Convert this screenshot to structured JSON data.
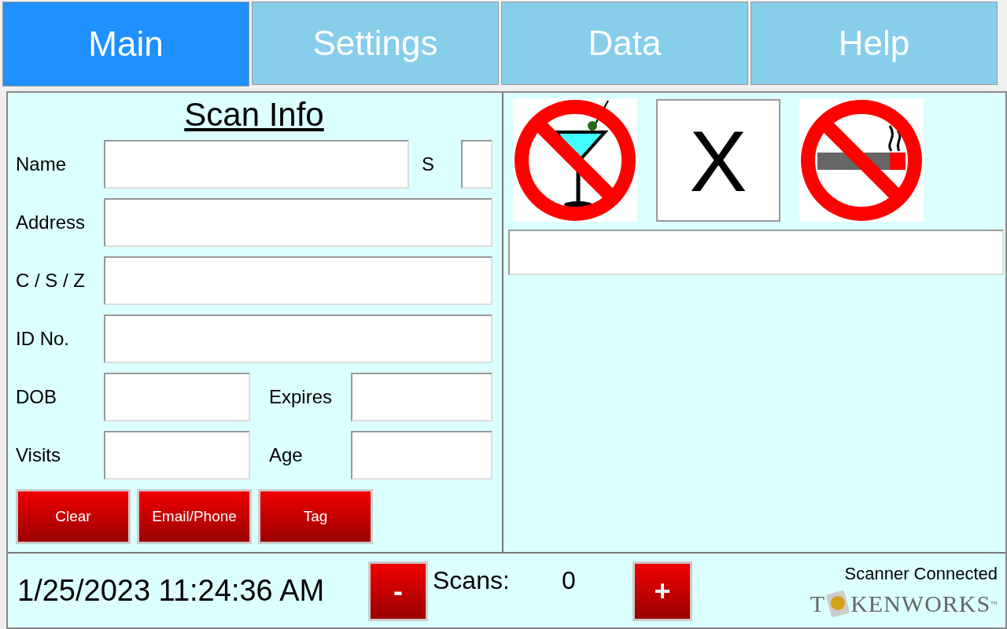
{
  "tabs": [
    {
      "label": "Main",
      "selected": true
    },
    {
      "label": "Settings",
      "selected": false
    },
    {
      "label": "Data",
      "selected": false
    },
    {
      "label": "Help",
      "selected": false
    }
  ],
  "scan_info": {
    "title": "Scan Info",
    "rows": [
      {
        "kind": "wide_with_side",
        "label": "Name",
        "side_label": "S"
      },
      {
        "kind": "wide",
        "label": "Address"
      },
      {
        "kind": "wide",
        "label": "C / S / Z"
      },
      {
        "kind": "wide",
        "label": "ID No."
      },
      {
        "kind": "pair",
        "label": "DOB",
        "side_label": "Expires"
      },
      {
        "kind": "pair",
        "label": "Visits",
        "side_label": "Age"
      }
    ],
    "buttons": [
      "Clear",
      "Email/Phone",
      "Tag"
    ]
  },
  "status_icons": [
    {
      "kind": "no_alcohol"
    },
    {
      "kind": "text",
      "text": "X"
    },
    {
      "kind": "no_smoking"
    }
  ],
  "footer": {
    "datetime": "1/25/2023 11:24:36 AM",
    "minus": "-",
    "scans_label": "Scans:",
    "scans_value": "0",
    "plus": "+",
    "scanner_status": "Scanner Connected",
    "logo_start": "T",
    "logo_end": "KENWORKS",
    "logo_mark": "™"
  }
}
